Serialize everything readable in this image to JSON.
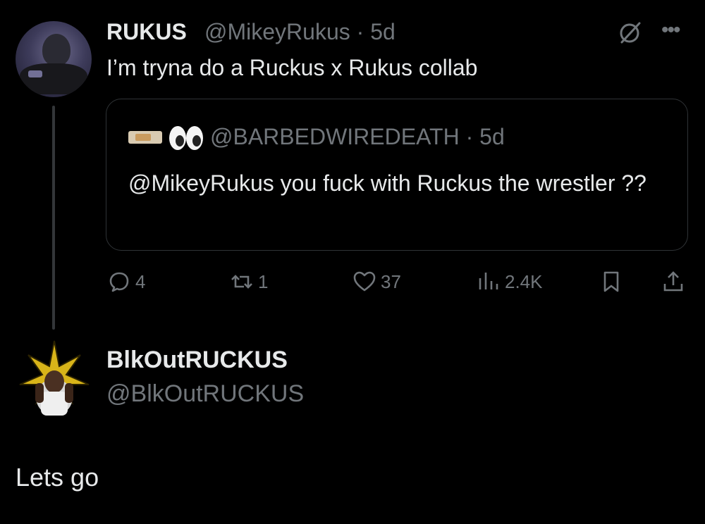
{
  "tweet": {
    "name": "RUKUS",
    "handle_time": "@MikeyRukus · 5d",
    "text": "I’m tryna do a Ruckus x Rukus collab",
    "quote": {
      "handle_time": "@BARBEDWIREDEATH · 5d",
      "text": "@MikeyRukus you fuck with Ruckus the wrestler ??"
    },
    "actions": {
      "replies": "4",
      "reposts": "1",
      "likes": "37",
      "views": "2.4K"
    }
  },
  "reply_author": {
    "name": "BlkOutRUCKUS",
    "handle": "@BlkOutRUCKUS"
  },
  "reply_text": "Lets go",
  "icons": [
    "grok-icon",
    "more-icon",
    "reply-icon",
    "repost-icon",
    "like-icon",
    "views-icon",
    "bookmark-icon",
    "share-icon"
  ],
  "colors": {
    "background": "#000000",
    "text": "#e7e9ea",
    "muted": "#71767b",
    "border": "#2f3336"
  }
}
